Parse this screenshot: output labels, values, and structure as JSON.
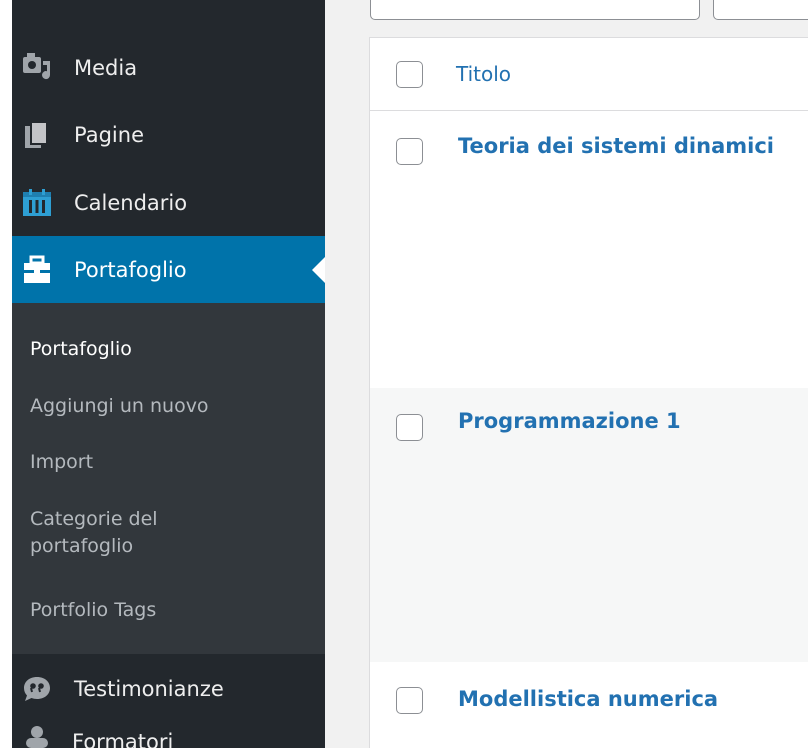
{
  "sidebar": {
    "items": [
      {
        "label": "Media",
        "icon": "media-icon"
      },
      {
        "label": "Pagine",
        "icon": "pages-icon"
      },
      {
        "label": "Calendario",
        "icon": "calendar-icon"
      },
      {
        "label": "Portafoglio",
        "icon": "portfolio-icon",
        "current": true
      },
      {
        "label": "Testimonianze",
        "icon": "testimonial-icon"
      }
    ],
    "submenu": [
      {
        "label": "Portafoglio",
        "active": true
      },
      {
        "label": "Aggiungi un nuovo"
      },
      {
        "label": "Import"
      },
      {
        "label": "Categorie del portafoglio"
      },
      {
        "label": "Portfolio Tags"
      }
    ],
    "partial_item_label": "Formatori"
  },
  "table": {
    "column_title": "Titolo",
    "rows": [
      {
        "title": "Teoria dei sistemi dinamici"
      },
      {
        "title": "Programmazione 1"
      },
      {
        "title": "Modellistica numerica"
      }
    ]
  },
  "colors": {
    "sidebar_bg": "#23282d",
    "submenu_bg": "#32373c",
    "accent": "#0073aa",
    "link": "#2271b1",
    "calendar_icon": "#2e9fd3"
  }
}
